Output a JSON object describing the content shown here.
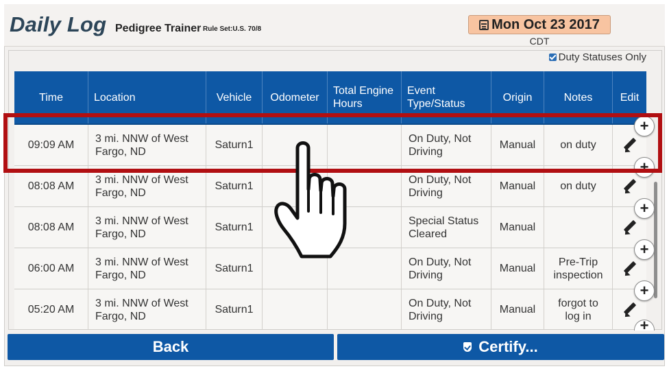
{
  "header": {
    "title": "Daily Log",
    "user": "Pedigree Trainer",
    "rule_set": "Rule Set:U.S. 70/8",
    "date": "Mon Oct 23 2017",
    "timezone": "CDT"
  },
  "filter": {
    "label": "Duty Statuses Only",
    "checked": true
  },
  "table": {
    "columns": [
      "Time",
      "Location",
      "Vehicle",
      "Odometer",
      "Total Engine Hours",
      "Event Type/Status",
      "Origin",
      "Notes",
      "Edit"
    ],
    "rows": [
      {
        "time": "09:09 AM",
        "location": "3 mi. NNW of West Fargo, ND",
        "vehicle": "Saturn1",
        "odometer": "",
        "engine_hours": "",
        "event": "On Duty, Not Driving",
        "origin": "Manual",
        "notes": "on duty"
      },
      {
        "time": "08:08 AM",
        "location": "3 mi. NNW of West Fargo, ND",
        "vehicle": "Saturn1",
        "odometer": "",
        "engine_hours": "",
        "event": "On Duty, Not Driving",
        "origin": "Manual",
        "notes": "on duty"
      },
      {
        "time": "08:08 AM",
        "location": "3 mi. NNW of West Fargo, ND",
        "vehicle": "Saturn1",
        "odometer": "",
        "engine_hours": "",
        "event": "Special Status Cleared",
        "origin": "Manual",
        "notes": ""
      },
      {
        "time": "06:00 AM",
        "location": "3 mi. NNW of West Fargo, ND",
        "vehicle": "Saturn1",
        "odometer": "",
        "engine_hours": "",
        "event": "On Duty, Not Driving",
        "origin": "Manual",
        "notes": "Pre-Trip inspection"
      },
      {
        "time": "05:20 AM",
        "location": "3 mi. NNW of West Fargo, ND",
        "vehicle": "Saturn1",
        "odometer": "",
        "engine_hours": "",
        "event": "On Duty, Not Driving",
        "origin": "Manual",
        "notes": "forgot to log in"
      }
    ]
  },
  "insert_button_label": "+",
  "footer": {
    "back_label": "Back",
    "certify_label": "Certify..."
  },
  "colors": {
    "primary": "#0e58a5",
    "date_bg": "#f8c4a1",
    "highlight": "#b10f12",
    "title": "#2c4558"
  },
  "icons": [
    "calendar-icon",
    "checkbox-icon",
    "pencil-icon",
    "plus-icon",
    "shield-check-icon",
    "hand-pointer-icon"
  ]
}
